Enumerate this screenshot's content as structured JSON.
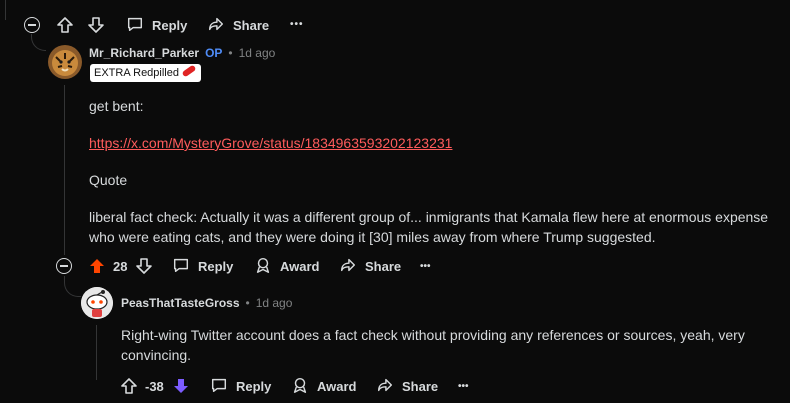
{
  "top_actions": {
    "reply": "Reply",
    "share": "Share",
    "more": "•••"
  },
  "comment1": {
    "username": "Mr_Richard_Parker",
    "op_badge": "OP",
    "separator": "•",
    "time": "1d ago",
    "flair": "EXTRA Redpilled",
    "lines": {
      "p1": "get bent:",
      "link": "https://x.com/MysteryGrove/status/1834963593202123231",
      "p2": "Quote",
      "p3": "liberal fact check: Actually it was a different group of... inmigrants that Kamala flew here at enormous expense who were eating cats, and they were doing it [30] miles away from where Trump suggested."
    },
    "score": "28",
    "reply": "Reply",
    "award": "Award",
    "share": "Share",
    "more": "•••",
    "vote_color": "#ff4500"
  },
  "comment2": {
    "username": "PeasThatTasteGross",
    "separator": "•",
    "time": "1d ago",
    "body": "Right-wing Twitter account does a fact check without providing any references or sources, yeah, very convincing.",
    "score": "-38",
    "reply": "Reply",
    "award": "Award",
    "share": "Share",
    "more": "•••",
    "vote_color": "#7c5cff"
  }
}
